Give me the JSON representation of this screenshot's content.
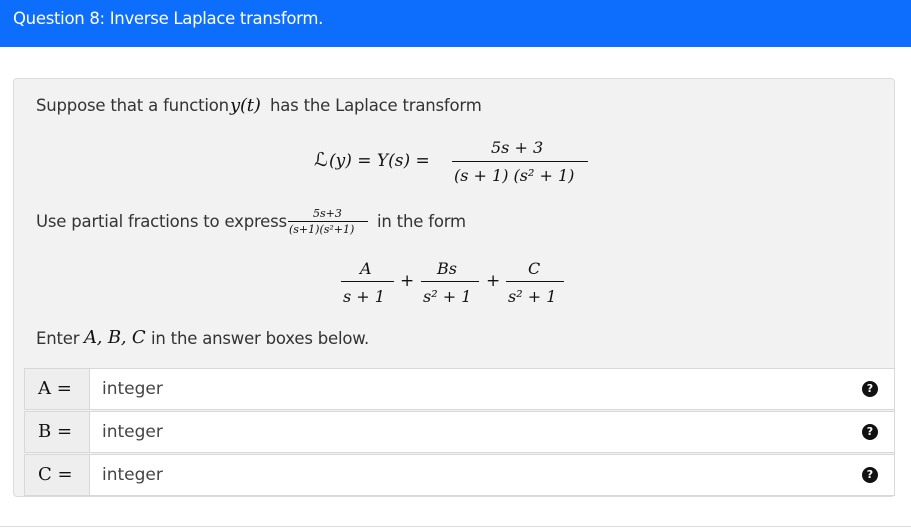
{
  "header": {
    "title": "Question 8: Inverse Laplace transform."
  },
  "prompt": {
    "line1_text": "Suppose that a function",
    "line1_math": "y(t)",
    "line1_tail": "has the Laplace transform",
    "equation": {
      "lhs_L": "ℒ",
      "lhs_rest": "(y) = Y(s) =",
      "numerator": "5s + 3",
      "denominator": "(s + 1) (s² + 1)"
    },
    "line2_text": "Use partial fractions to express",
    "line2_num": "5s+3",
    "line2_den": "(s+1)(s²+1)",
    "line2_tail": "in the form",
    "form": {
      "t1_num": "A",
      "t1_den": "s + 1",
      "plus1": "+",
      "t2_num": "Bs",
      "t2_den": "s² + 1",
      "plus2": "+",
      "t3_num": "C",
      "t3_den": "s² + 1"
    },
    "line3_text": "Enter",
    "line3_math": "A, B, C",
    "line3_tail": "in the answer boxes below."
  },
  "answers": [
    {
      "label": "A =",
      "value": "",
      "placeholder": "integer",
      "help": "?"
    },
    {
      "label": "B =",
      "value": "",
      "placeholder": "integer",
      "help": "?"
    },
    {
      "label": "C =",
      "value": "",
      "placeholder": "integer",
      "help": "?"
    }
  ],
  "colors": {
    "header": "#0d6efd",
    "card": "#f2f2f2",
    "help_icon": "#111111"
  }
}
